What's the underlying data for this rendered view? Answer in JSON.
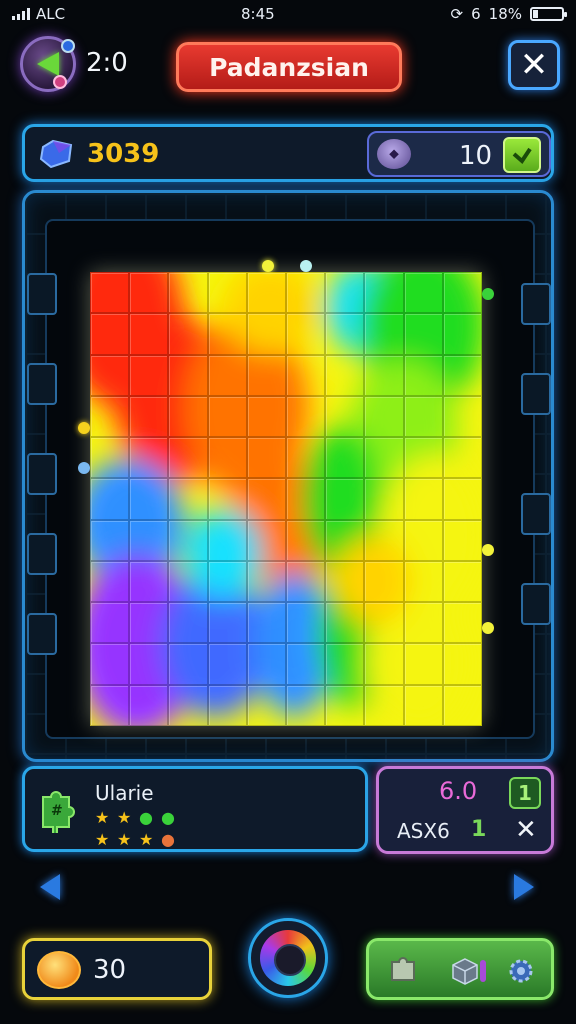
{
  "status_bar": {
    "carrier": "ALC",
    "time": "8:45",
    "battery": "18%",
    "battery_level": 0.18,
    "status_icon": "6"
  },
  "header": {
    "timer": "2:0",
    "title": "Padanzsian",
    "close_label": "✕"
  },
  "score_bar": {
    "score": "3039",
    "moves": "10"
  },
  "puzzle": {
    "rows": 11,
    "cols": 10,
    "palette": [
      "#e8331f",
      "#f5781a",
      "#f6d21e",
      "#f2f23a",
      "#9ae83a",
      "#3ad23a",
      "#37d9f0",
      "#3f8ef0",
      "#4a6ae8",
      "#8a3ae8"
    ]
  },
  "info_panel": {
    "label": "Ularie",
    "stars": [
      "★",
      "★",
      "●",
      "●",
      "★",
      "★",
      "★",
      "●"
    ]
  },
  "stats_panel": {
    "top_value": "6.0",
    "check_value": "1",
    "code": "ASX6",
    "count": "1",
    "close_label": "✕"
  },
  "bottom": {
    "coins": "30"
  },
  "colors": {
    "accent": "#2aa6e8",
    "title_red": "#e83a30",
    "score_gold": "#f6c21a",
    "coin_gold": "#e8d23a",
    "tools_green": "#5ab84a",
    "stat_pink": "#e96ad8"
  }
}
